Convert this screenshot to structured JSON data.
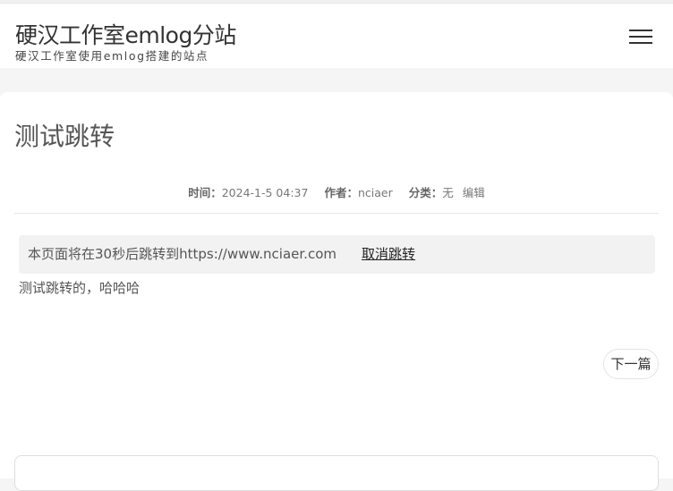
{
  "header": {
    "site_title": "硬汉工作室emlog分站",
    "site_subtitle": "硬汉工作室使用emlog搭建的站点",
    "menu_icon": "hamburger-menu-icon"
  },
  "article": {
    "title": "测试跳转",
    "meta": {
      "time_label": "时间：",
      "time_value": "2024-1-5 04:37",
      "author_label": "作者：",
      "author_value": "nciaer",
      "category_label": "分类：",
      "category_value": "无",
      "edit_label": "编辑"
    },
    "redirect": {
      "message": "本页面将在30秒后跳转到https://www.nciaer.com",
      "cancel_label": "取消跳转"
    },
    "content": "测试跳转的，哈哈哈",
    "next_label": "下一篇"
  }
}
